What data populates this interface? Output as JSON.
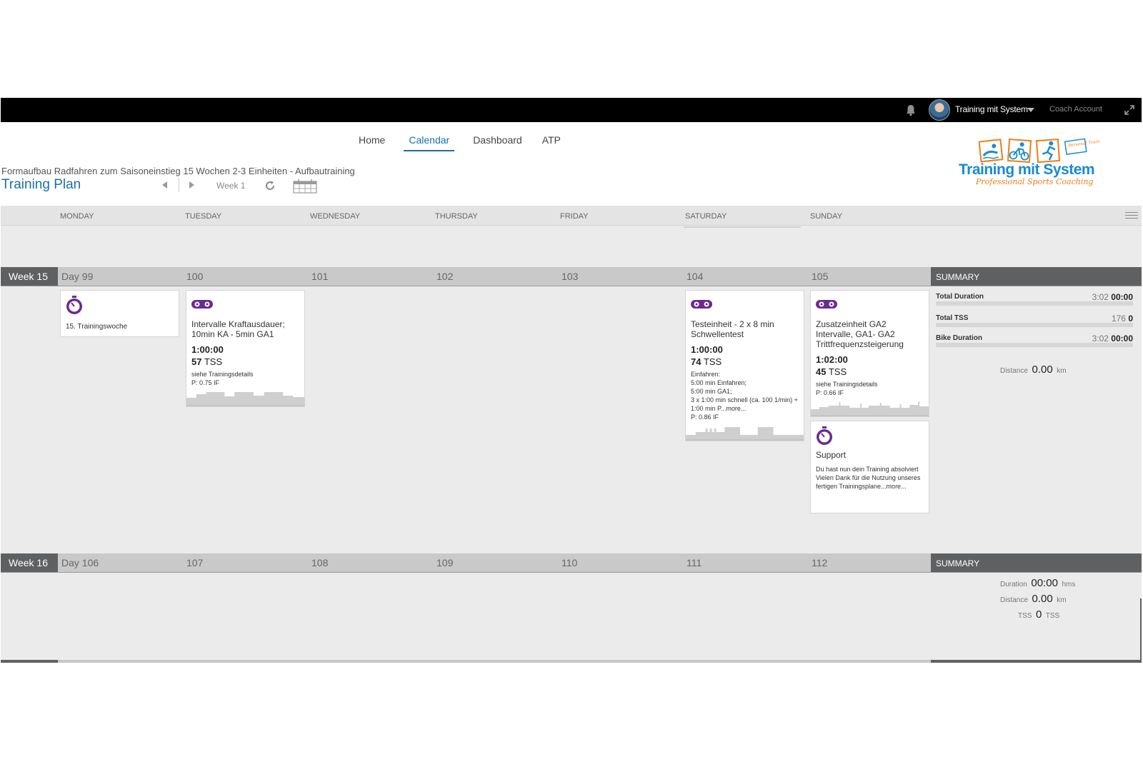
{
  "topbar": {
    "user_name": "Training mit System",
    "account_label": "Coach Account"
  },
  "nav": {
    "items": [
      "Home",
      "Calendar",
      "Dashboard",
      "ATP"
    ],
    "active": "Calendar"
  },
  "plan": {
    "subtitle": "Formaufbau Radfahren zum Saisoneinstieg 15 Wochen 2-3 Einheiten - Aufbautraining",
    "title": "Training Plan",
    "week_label": "Week 1"
  },
  "logo": {
    "brand": "Training mit System",
    "tagline": "Professional Sports Coaching",
    "badge": "Personal Training"
  },
  "days": [
    "MONDAY",
    "TUESDAY",
    "WEDNESDAY",
    "THURSDAY",
    "FRIDAY",
    "SATURDAY",
    "SUNDAY"
  ],
  "weeks": [
    {
      "label": "Week 15",
      "day_numbers": [
        "Day 99",
        "100",
        "101",
        "102",
        "103",
        "104",
        "105"
      ],
      "summary_label": "SUMMARY",
      "summary": {
        "total_duration_label": "Total Duration",
        "total_duration_planned": "3:02",
        "total_duration_done": "00:00",
        "total_tss_label": "Total TSS",
        "total_tss_planned": "176",
        "total_tss_done": "0",
        "bike_duration_label": "Bike Duration",
        "bike_duration_planned": "3:02",
        "bike_duration_done": "00:00",
        "distance_label": "Distance",
        "distance_value": "0.00",
        "distance_unit": "km"
      },
      "cards": {
        "monday": {
          "icon": "stopwatch-icon",
          "title": "15. Trainingswoche"
        },
        "tuesday": {
          "icon": "bike-icon",
          "title": "Intervalle Kraftausdauer; 10min KA - 5min GA1",
          "duration": "1:00:00",
          "tss_value": "57",
          "tss_unit": "TSS",
          "note": "siehe Trainingsdetails\nP: 0.75 IF"
        },
        "saturday": {
          "icon": "bike-icon",
          "title": "Testeinheit - 2 x 8 min Schwellentest",
          "duration": "1:00:00",
          "tss_value": "74",
          "tss_unit": "TSS",
          "note": "Einfahren:\n5:00 min Einfahren;\n5:00 min GA1;\n3 x 1:00 min schnell (ca. 100 1/min) + 1:00 min P...more...\nP: 0.86 IF"
        },
        "sunday": {
          "icon": "bike-icon",
          "title": "Zusatzeinheit   GA2 Intervalle, GA1- GA2 Trittfrequenzsteigerung",
          "duration": "1:02:00",
          "tss_value": "45",
          "tss_unit": "TSS",
          "note": "siehe Trainingsdetails\nP: 0.66 IF"
        },
        "sunday_support": {
          "icon": "stopwatch-icon",
          "title": "Support",
          "note": "Du hast nun dein Training absolviert\nVielen Dank für die Nutzung unseres fertigen Trainingsplane...more..."
        }
      }
    },
    {
      "label": "Week 16",
      "day_numbers": [
        "Day 106",
        "107",
        "108",
        "109",
        "110",
        "111",
        "112"
      ],
      "summary_label": "SUMMARY",
      "summary": {
        "duration_label": "Duration",
        "duration_value": "00:00",
        "duration_unit": "hms",
        "distance_label": "Distance",
        "distance_value": "0.00",
        "distance_unit": "km",
        "tss_label": "TSS",
        "tss_value": "0",
        "tss_unit": "TSS"
      }
    }
  ],
  "colors": {
    "accent": "#1b6fa8",
    "workout_icon": "#6a2a8e",
    "week_label_bg": "#5f6062",
    "logo_blue": "#1b8ad0",
    "logo_orange": "#f07c1a"
  }
}
